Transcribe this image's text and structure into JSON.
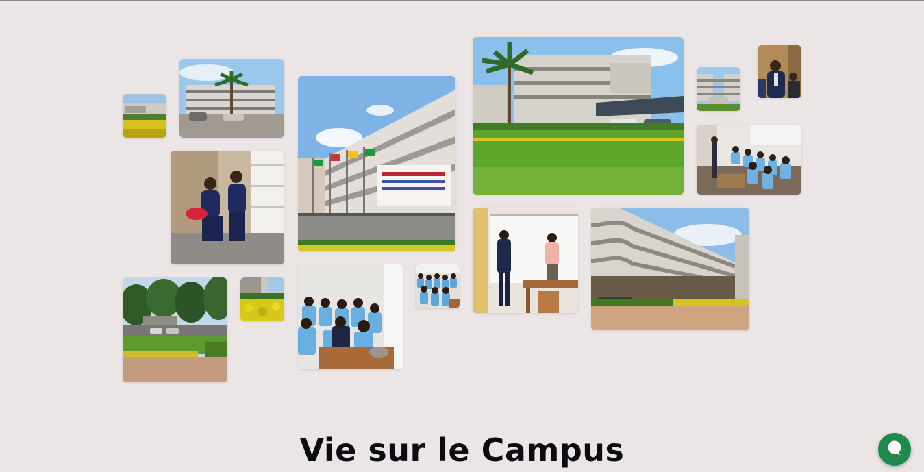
{
  "section": {
    "title": "Vie sur le Campus"
  },
  "gallery": {
    "photos": [
      {
        "name": "photo-garden-small",
        "subject": "garden"
      },
      {
        "name": "photo-building-palm-left",
        "subject": "building"
      },
      {
        "name": "photo-students-sitting",
        "subject": "students"
      },
      {
        "name": "photo-building-flags",
        "subject": "building-flags"
      },
      {
        "name": "photo-building-palm-large",
        "subject": "building-lawn"
      },
      {
        "name": "photo-building-courtyard-small",
        "subject": "courtyard"
      },
      {
        "name": "photo-speaker-small",
        "subject": "speaker"
      },
      {
        "name": "photo-classroom-right",
        "subject": "classroom"
      },
      {
        "name": "photo-campus-trees",
        "subject": "trees"
      },
      {
        "name": "photo-flowers-small",
        "subject": "flowers"
      },
      {
        "name": "photo-classroom-students",
        "subject": "classroom"
      },
      {
        "name": "photo-students-group-small",
        "subject": "students-group"
      },
      {
        "name": "photo-whiteboard",
        "subject": "whiteboard"
      },
      {
        "name": "photo-building-curved",
        "subject": "building-curved"
      }
    ]
  },
  "chat": {
    "icon": "chat-bubble-icon",
    "color": "#1f8a4c"
  },
  "colors": {
    "background": "#ebe6e5",
    "title": "#0b0b12"
  }
}
